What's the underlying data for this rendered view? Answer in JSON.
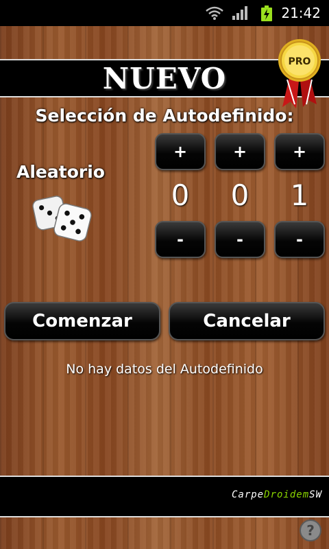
{
  "status_bar": {
    "time": "21:42",
    "icons": [
      "wifi-icon",
      "signal-icon",
      "battery-charging-icon"
    ]
  },
  "header": {
    "title": "NUEVO",
    "badge_text": "PRO"
  },
  "section_title": "Selección de Autodefinido:",
  "random": {
    "label": "Aleatorio",
    "icon": "dice-icon"
  },
  "selectors": [
    {
      "plus_label": "+",
      "value": "0",
      "minus_label": "-"
    },
    {
      "plus_label": "+",
      "value": "0",
      "minus_label": "-"
    },
    {
      "plus_label": "+",
      "value": "1",
      "minus_label": "-"
    }
  ],
  "actions": {
    "start_label": "Comenzar",
    "cancel_label": "Cancelar"
  },
  "info_text": "No hay datos del Autodefinido",
  "footer": {
    "brand_part1": "Carpe",
    "brand_part2": "Droidem",
    "brand_part3": "SW"
  },
  "colors": {
    "bar_background": "#000000",
    "brand_accent": "#8bd600",
    "text": "#ffffff"
  }
}
